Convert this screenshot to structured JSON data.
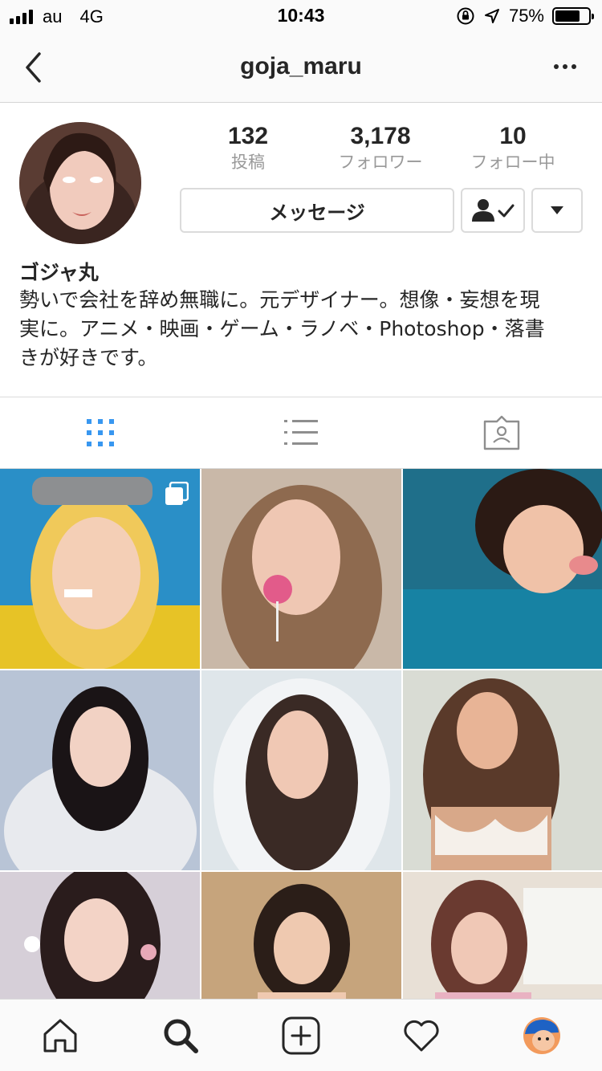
{
  "status_bar": {
    "carrier": "au",
    "network": "4G",
    "time": "10:43",
    "battery_percent_text": "75%",
    "battery_level": 0.75,
    "icons": [
      "signal-bars-icon",
      "orientation-lock-icon",
      "location-arrow-icon",
      "battery-icon"
    ]
  },
  "nav": {
    "title": "goja_maru",
    "back_icon": "chevron-left-icon",
    "more_icon": "more-dots-icon"
  },
  "profile": {
    "stats": [
      {
        "value": "132",
        "label": "投稿"
      },
      {
        "value": "3,178",
        "label": "フォロワー"
      },
      {
        "value": "10",
        "label": "フォロー中"
      }
    ],
    "message_button": "メッセージ",
    "following_icon": "person-check-icon",
    "dropdown_icon": "caret-down-icon",
    "display_name": "ゴジャ丸",
    "bio_lines": [
      "勢いで会社を辞め無職に。元デザイナー。想像・妄想を現",
      "実に。アニメ・映画・ゲーム・ラノベ・Photoshop・落書",
      "きが好きです。"
    ]
  },
  "tabs": [
    {
      "icon": "grid-view-icon",
      "active": true
    },
    {
      "icon": "list-view-icon",
      "active": false
    },
    {
      "icon": "tagged-photos-icon",
      "active": false
    }
  ],
  "colors": {
    "accent_blue": "#3897f0",
    "text": "#262626",
    "muted": "#999999",
    "border": "#dbdbdb"
  },
  "tab_bar": [
    {
      "icon": "home-icon"
    },
    {
      "icon": "search-icon",
      "active": true
    },
    {
      "icon": "add-post-icon"
    },
    {
      "icon": "activity-heart-icon"
    },
    {
      "icon": "profile-avatar-icon"
    }
  ]
}
